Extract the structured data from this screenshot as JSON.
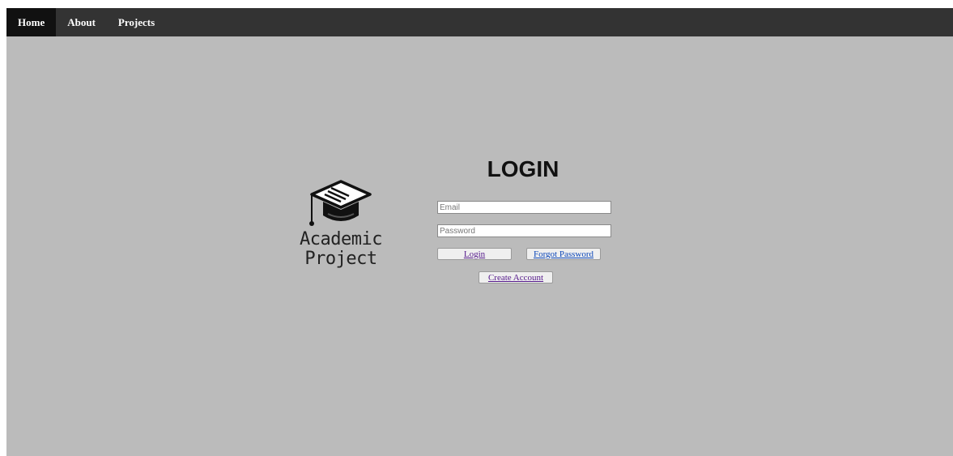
{
  "navbar": {
    "items": [
      {
        "label": "Home",
        "active": true
      },
      {
        "label": "About",
        "active": false
      },
      {
        "label": "Projects",
        "active": false
      }
    ]
  },
  "logo": {
    "icon": "graduation-cap-icon",
    "line1": "Academic",
    "line2": "Project"
  },
  "login": {
    "title": "LOGIN",
    "email_placeholder": "Email",
    "password_placeholder": "Password",
    "login_label": "Login",
    "forgot_label": "Forgot Password",
    "create_label": "Create Account"
  },
  "colors": {
    "navbar_bg": "#333333",
    "nav_active_bg": "#111111",
    "page_bg": "#bbbbbb",
    "visited_link": "#551a8b",
    "link": "#0b46b8"
  }
}
